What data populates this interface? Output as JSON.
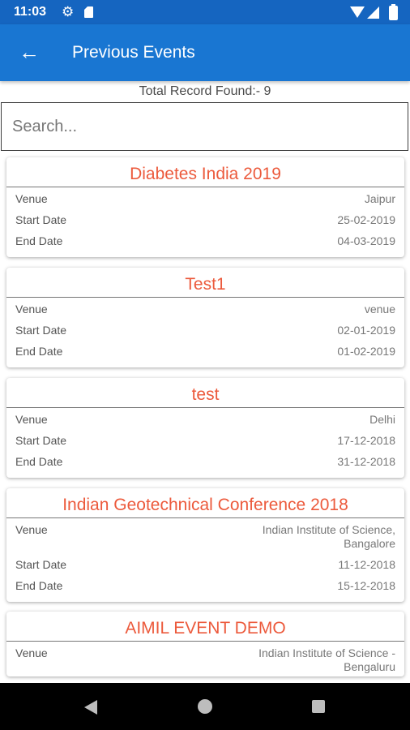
{
  "status_bar": {
    "time": "11:03",
    "icons": [
      "gear-icon",
      "sd-card-icon",
      "wifi-icon",
      "signal-icon",
      "battery-icon"
    ]
  },
  "app_bar": {
    "title": "Previous Events",
    "back_icon": "arrow-left-icon"
  },
  "summary": {
    "total_text": "Total Record Found:- 9"
  },
  "search": {
    "placeholder": "Search...",
    "value": ""
  },
  "labels": {
    "venue": "Venue",
    "start": "Start Date",
    "end": "End Date"
  },
  "events": [
    {
      "title": "Diabetes India 2019",
      "venue": "Jaipur",
      "start": "25-02-2019",
      "end": "04-03-2019"
    },
    {
      "title": "Test1",
      "venue": "venue",
      "start": "02-01-2019",
      "end": "01-02-2019"
    },
    {
      "title": "test",
      "venue": "Delhi",
      "start": "17-12-2018",
      "end": "31-12-2018"
    },
    {
      "title": "Indian Geotechnical Conference 2018",
      "venue": "Indian Institute of Science, Bangalore",
      "start": "11-12-2018",
      "end": "15-12-2018"
    },
    {
      "title": "AIMIL EVENT DEMO",
      "venue": "Indian Institute of Science - Bengaluru"
    }
  ],
  "nav_bar": {
    "icons": [
      "back-triangle-icon",
      "home-circle-icon",
      "recents-square-icon"
    ]
  },
  "colors": {
    "status_bar": "#1565c0",
    "app_bar": "#1976d2",
    "event_title": "#ec5a3c"
  }
}
